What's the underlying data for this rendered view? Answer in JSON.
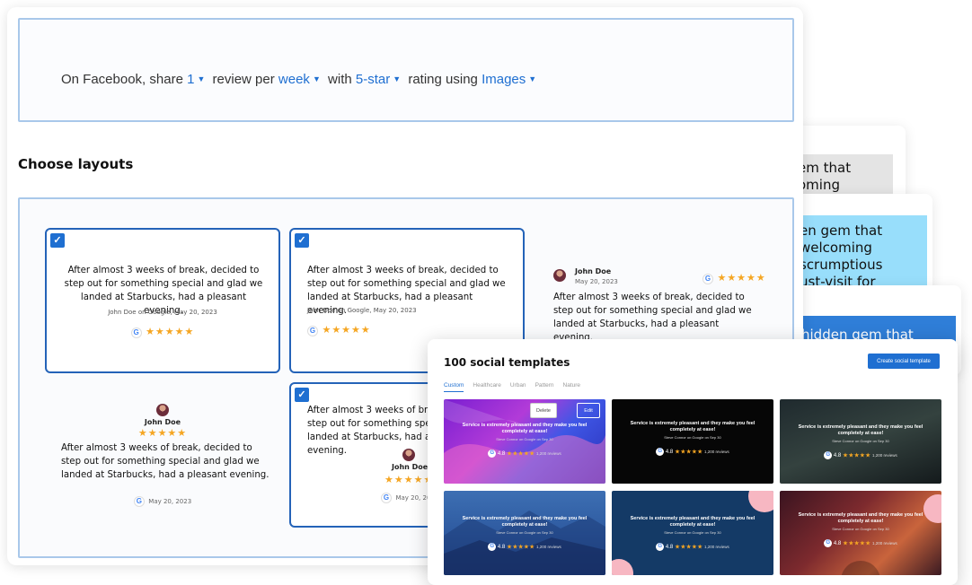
{
  "schedule": {
    "prefix": "On Facebook, share",
    "count": "1",
    "middle1": "review per",
    "period": "week",
    "middle2": "with",
    "rating": "5-star",
    "middle3": "rating using",
    "media": "Images"
  },
  "layouts": {
    "title": "Choose layouts",
    "review_text": "After almost 3 weeks of break, decided to step out for something special and glad we landed at Starbucks, had a pleasant evening.",
    "card_meta": "John Doe on Google, May 20, 2023",
    "reviewer_name": "John Doe",
    "review_date": "May 20, 2023",
    "date_short": "May 20, 2023",
    "stars": "★★★★★",
    "google_glyph": "G",
    "check_glyph": "✓"
  },
  "background_snippets": {
    "snip1": "em that\noming",
    "snip2": "en gem that\nwelcoming\nscrumptious\nust-visit for",
    "snip3": "hidden gem that"
  },
  "templates": {
    "title": "100 social templates",
    "create_button": "Create social template",
    "tabs": [
      "Custom",
      "Healthcare",
      "Urban",
      "Pattern",
      "Nature"
    ],
    "active_tab": "Custom",
    "delete_label": "Delete",
    "edit_label": "Edit",
    "quote": "Service is extremely pleasant and they make you feel completely at ease!",
    "author": "Steve Connor on Google on Sep 30",
    "rating": "4.8",
    "stars": "★★★★★",
    "count": "1,200 reviews",
    "google_glyph": "G"
  },
  "colors": {
    "accent": "#1f6fd1",
    "selected_border": "#2463b8",
    "star": "#f5a623"
  }
}
